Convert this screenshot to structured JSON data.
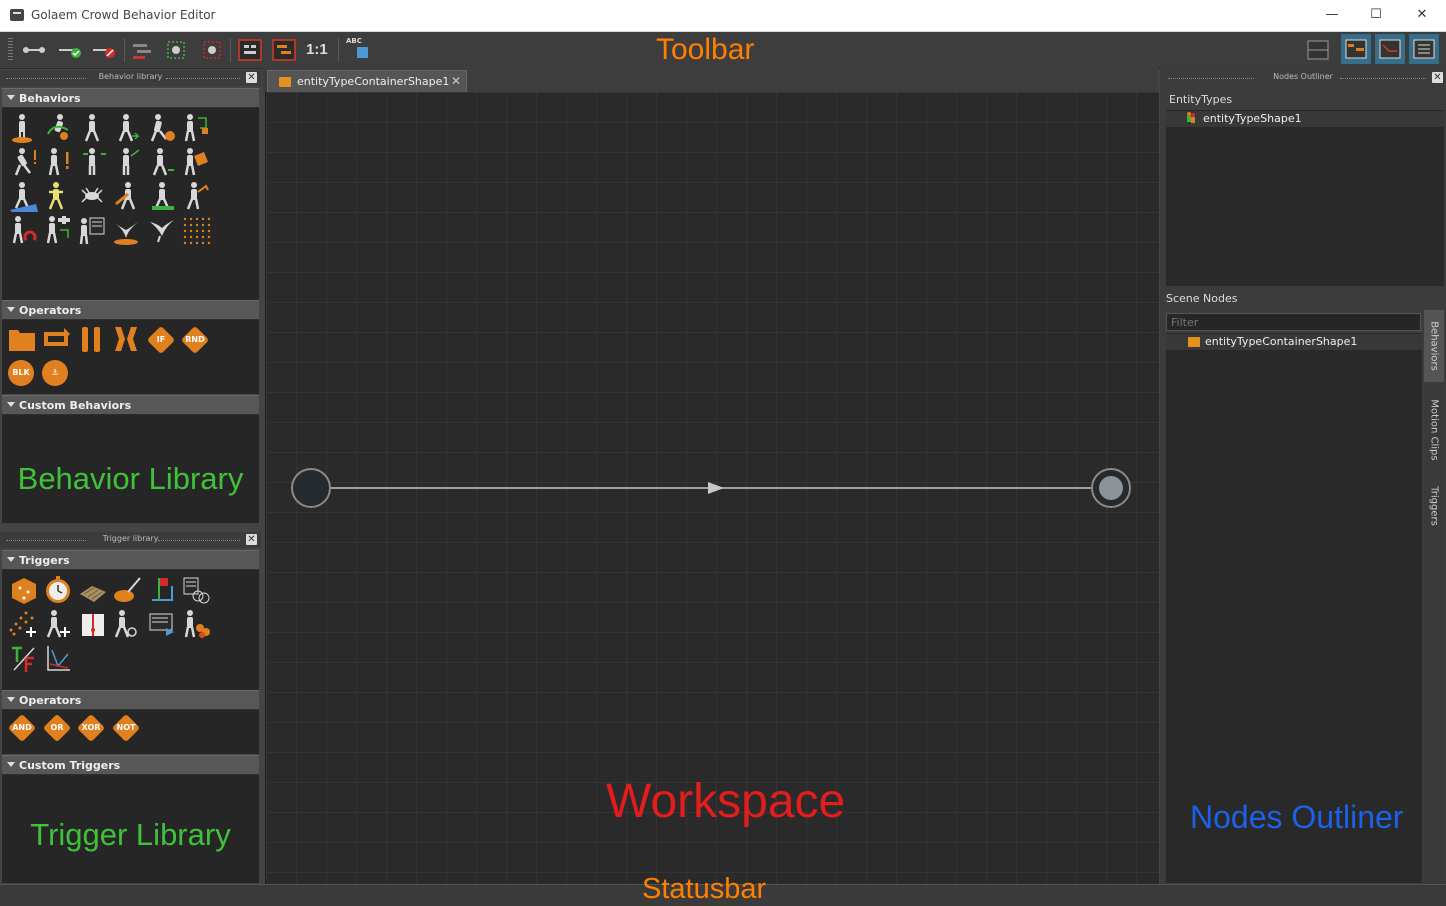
{
  "window": {
    "title": "Golaem Crowd Behavior Editor",
    "controls": {
      "minimize": "—",
      "maximize": "☐",
      "close": "✕"
    }
  },
  "toolbar": {
    "label": "Toolbar",
    "zoom_reset": "1:1",
    "abc": "ABC"
  },
  "behavior_library": {
    "panel_title": "Behavior library",
    "sections": {
      "behaviors": "Behaviors",
      "operators": "Operators",
      "custom": "Custom Behaviors"
    },
    "placeholder": "Behavior Library",
    "operator_badges": [
      "IF",
      "RND",
      "BLK"
    ]
  },
  "trigger_library": {
    "panel_title": "Trigger library",
    "sections": {
      "triggers": "Triggers",
      "operators": "Operators",
      "custom": "Custom Triggers"
    },
    "placeholder": "Trigger Library",
    "operators": [
      "AND",
      "OR",
      "XOR",
      "NOT"
    ]
  },
  "workspace": {
    "tab_label": "entityTypeContainerShape1",
    "tab_close": "✕",
    "label": "Workspace"
  },
  "outliner": {
    "panel_title": "Nodes Outliner",
    "entity_types_label": "EntityTypes",
    "entity_type_item": "entityTypeShape1",
    "scene_nodes_label": "Scene Nodes",
    "filter_placeholder": "Filter",
    "scene_node_item": "entityTypeContainerShape1",
    "side_tabs": [
      "Behaviors",
      "Motion Clips",
      "Triggers"
    ],
    "label": "Nodes Outliner"
  },
  "statusbar": {
    "label": "Statusbar"
  },
  "colors": {
    "accent_orange": "#e0801f",
    "label_orange": "#ff7f00",
    "label_green": "#3fc23a",
    "label_red": "#e31c1c",
    "label_blue": "#1a62e8"
  }
}
